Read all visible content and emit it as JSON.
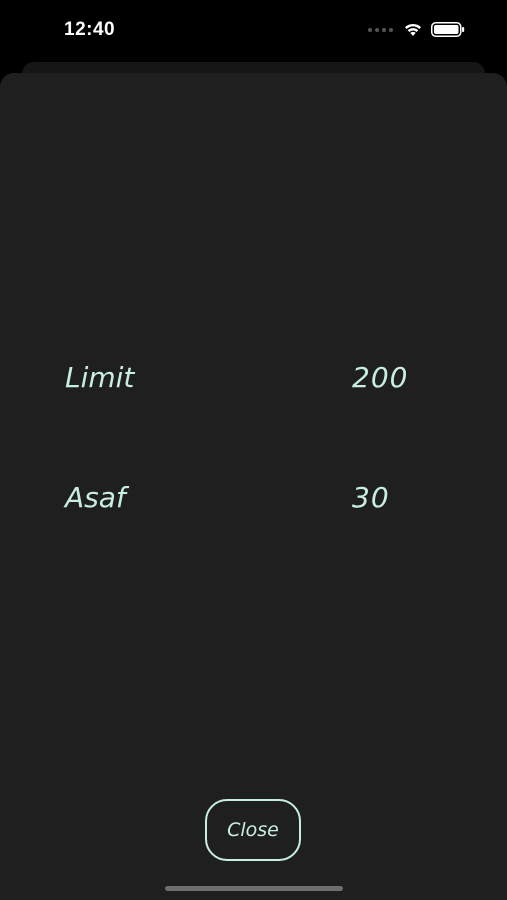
{
  "status_bar": {
    "time": "12:40",
    "icons": [
      "signal-dots-icon",
      "wifi-icon",
      "battery-icon"
    ]
  },
  "rows": [
    {
      "label": "Limit",
      "value": "200"
    },
    {
      "label": "Asaf",
      "value": "30"
    }
  ],
  "close_button": {
    "label": "Close"
  },
  "colors": {
    "accent": "#c8eee0",
    "sheet_background": "#1f1f1f",
    "screen_background": "#000000"
  }
}
